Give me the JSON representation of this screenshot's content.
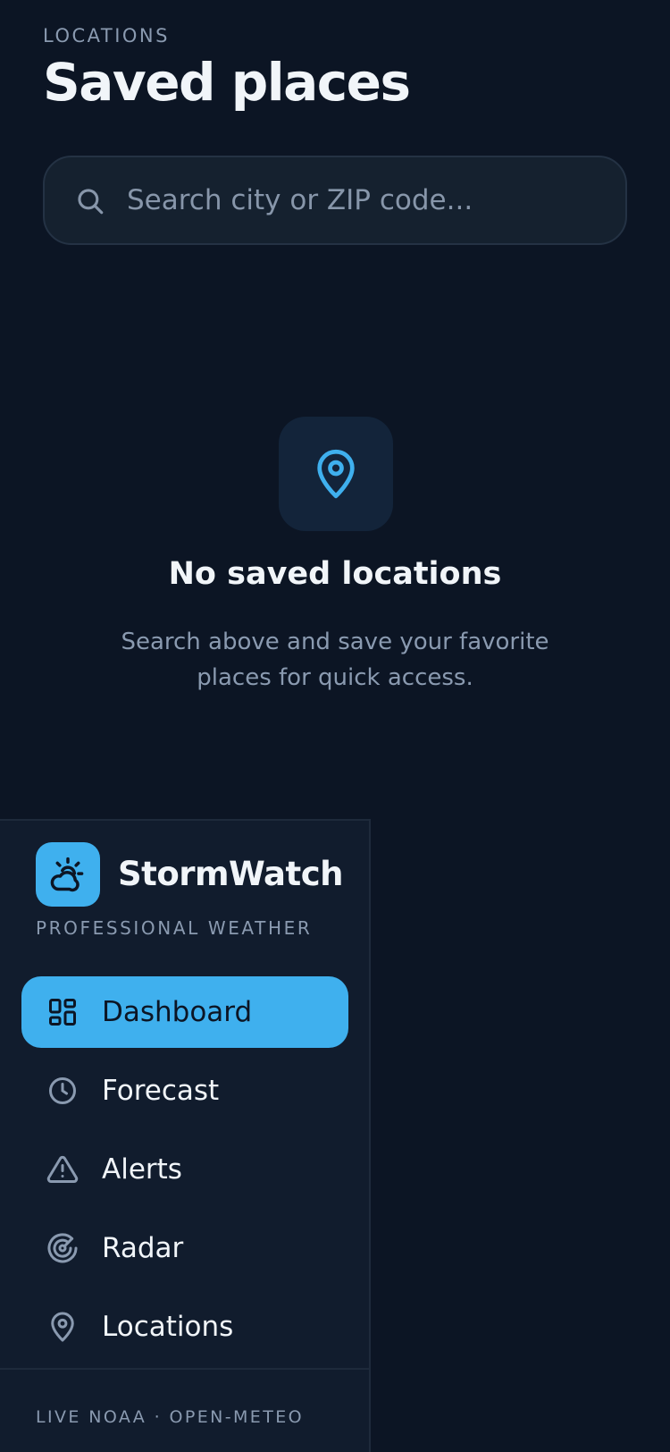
{
  "header": {
    "eyebrow": "LOCATIONS",
    "title": "Saved places"
  },
  "search": {
    "placeholder": "Search city or ZIP code...",
    "value": "",
    "icon": "search-icon"
  },
  "empty_state": {
    "icon": "map-pin-icon",
    "title": "No saved locations",
    "description": "Search above and save your favorite places for quick access."
  },
  "sidebar": {
    "brand": {
      "name": "StormWatch",
      "tagline": "PROFESSIONAL WEATHER",
      "logo_icon": "cloud-sun-icon"
    },
    "items": [
      {
        "label": "Dashboard",
        "icon": "dashboard-icon",
        "active": true
      },
      {
        "label": "Forecast",
        "icon": "clock-icon",
        "active": false
      },
      {
        "label": "Alerts",
        "icon": "warning-icon",
        "active": false
      },
      {
        "label": "Radar",
        "icon": "radar-icon",
        "active": false
      },
      {
        "label": "Locations",
        "icon": "map-pin-icon",
        "active": false
      }
    ],
    "footer": "LIVE NOAA · OPEN-METEO"
  },
  "colors": {
    "background": "#0c1524",
    "sidebar": "#111c2d",
    "accent": "#3fb0ee",
    "text_primary": "#f1f5f9",
    "text_muted": "#8a9ab0"
  }
}
